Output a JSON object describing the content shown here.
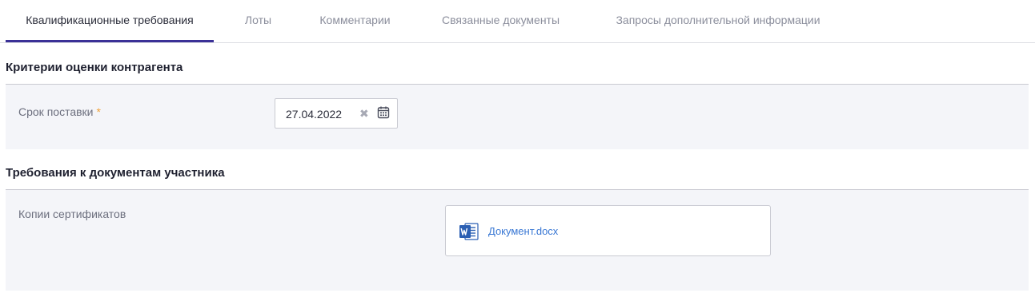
{
  "tabs": [
    {
      "label": "Квалификационные требования",
      "active": true
    },
    {
      "label": "Лоты",
      "active": false
    },
    {
      "label": "Комментарии",
      "active": false
    },
    {
      "label": "Связанные документы",
      "active": false
    },
    {
      "label": "Запросы дополнительной информации",
      "active": false
    }
  ],
  "sections": {
    "criteria": {
      "title": "Критерии оценки контрагента",
      "delivery_label": "Срок поставки",
      "required_mark": "*",
      "delivery_date": "27.04.2022",
      "clear_glyph": "✖"
    },
    "documents": {
      "title": "Требования к документам участника",
      "certificates_label": "Копии сертификатов",
      "file_name": "Документ.docx",
      "file_icon": "word-icon"
    }
  },
  "colors": {
    "accent": "#3b3197",
    "required": "#f0a23a",
    "link": "#3a78d4",
    "section_bg": "#f4f5f9"
  }
}
